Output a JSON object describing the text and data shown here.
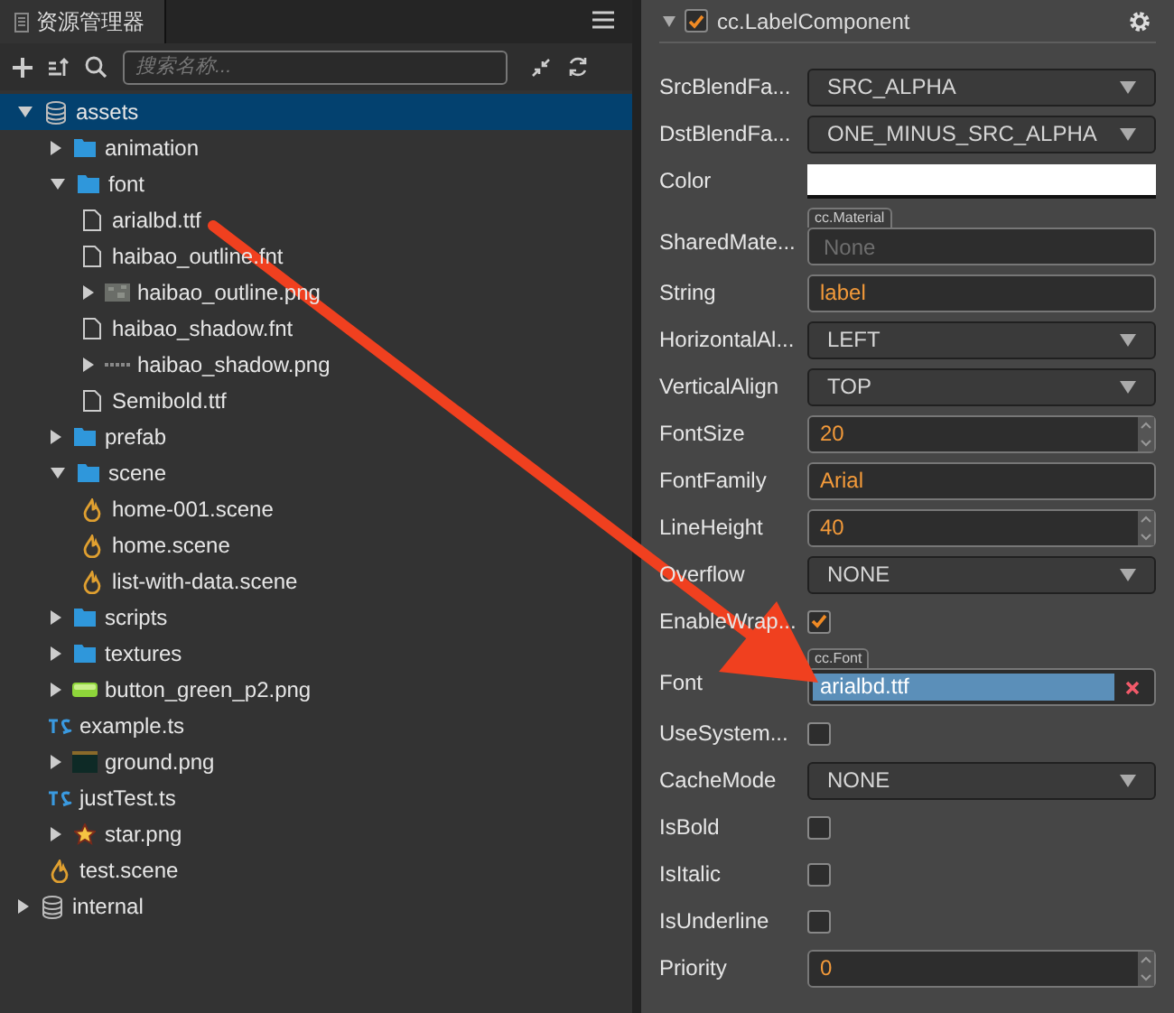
{
  "assets_panel": {
    "tab": {
      "label": "资源管理器",
      "selected": true
    },
    "search": {
      "placeholder": "搜索名称..."
    },
    "tree": [
      {
        "kind": "db",
        "name": "assets",
        "selected": true,
        "expanded": true,
        "children": [
          {
            "kind": "folder",
            "name": "animation",
            "selected": false,
            "expanded": false
          },
          {
            "kind": "folder",
            "name": "font",
            "selected": false,
            "expanded": true,
            "children": [
              {
                "kind": "file",
                "name": "arialbd.ttf",
                "selected": false
              },
              {
                "kind": "file",
                "name": "haibao_outline.fnt",
                "selected": false
              },
              {
                "kind": "texture",
                "name": "haibao_outline.png",
                "selected": false,
                "expanded": false
              },
              {
                "kind": "file",
                "name": "haibao_shadow.fnt",
                "selected": false
              },
              {
                "kind": "strip",
                "name": "haibao_shadow.png",
                "selected": false,
                "expanded": false
              },
              {
                "kind": "file",
                "name": "Semibold.ttf",
                "selected": false
              }
            ]
          },
          {
            "kind": "folder",
            "name": "prefab",
            "selected": false,
            "expanded": false
          },
          {
            "kind": "folder",
            "name": "scene",
            "selected": false,
            "expanded": true,
            "children": [
              {
                "kind": "scene",
                "name": "home-001.scene",
                "selected": false
              },
              {
                "kind": "scene",
                "name": "home.scene",
                "selected": false
              },
              {
                "kind": "scene",
                "name": "list-with-data.scene",
                "selected": false
              }
            ]
          },
          {
            "kind": "folder",
            "name": "scripts",
            "selected": false,
            "expanded": false
          },
          {
            "kind": "folder",
            "name": "textures",
            "selected": false,
            "expanded": false
          },
          {
            "kind": "greenbar",
            "name": "button_green_p2.png",
            "selected": false,
            "expanded": false
          },
          {
            "kind": "ts",
            "name": "example.ts",
            "selected": false
          },
          {
            "kind": "ground",
            "name": "ground.png",
            "selected": false,
            "expanded": false
          },
          {
            "kind": "ts",
            "name": "justTest.ts",
            "selected": false
          },
          {
            "kind": "star",
            "name": "star.png",
            "selected": false,
            "expanded": false
          },
          {
            "kind": "scene",
            "name": "test.scene",
            "selected": false
          }
        ]
      },
      {
        "kind": "db",
        "name": "internal",
        "selected": false,
        "expanded": false
      }
    ]
  },
  "inspector": {
    "component": {
      "name": "cc.LabelComponent",
      "enabled": true,
      "expanded": true
    },
    "properties": [
      {
        "kind": "select",
        "label": "SrcBlendFa...",
        "value": "SRC_ALPHA"
      },
      {
        "kind": "select",
        "label": "DstBlendFa...",
        "value": "ONE_MINUS_SRC_ALPHA"
      },
      {
        "kind": "color",
        "label": "Color",
        "color": "#ffffff"
      },
      {
        "kind": "asset",
        "label": "SharedMate...",
        "type_tag": "cc.Material",
        "placeholder": "None"
      },
      {
        "kind": "text",
        "label": "String",
        "value": "label"
      },
      {
        "kind": "select",
        "label": "HorizontalAl...",
        "value": "LEFT"
      },
      {
        "kind": "select",
        "label": "VerticalAlign",
        "value": "TOP"
      },
      {
        "kind": "number",
        "label": "FontSize",
        "value": "20"
      },
      {
        "kind": "text",
        "label": "FontFamily",
        "value": "Arial"
      },
      {
        "kind": "number",
        "label": "LineHeight",
        "value": "40"
      },
      {
        "kind": "select",
        "label": "Overflow",
        "value": "NONE"
      },
      {
        "kind": "checkbox",
        "label": "EnableWrap...",
        "checked": true
      },
      {
        "kind": "asset",
        "label": "Font",
        "type_tag": "cc.Font",
        "value": "arialbd.ttf"
      },
      {
        "kind": "checkbox",
        "label": "UseSystem...",
        "checked": false
      },
      {
        "kind": "select",
        "label": "CacheMode",
        "value": "NONE"
      },
      {
        "kind": "checkbox",
        "label": "IsBold",
        "checked": false
      },
      {
        "kind": "checkbox",
        "label": "IsItalic",
        "checked": false
      },
      {
        "kind": "checkbox",
        "label": "IsUnderline",
        "checked": false
      },
      {
        "kind": "number",
        "label": "Priority",
        "value": "0"
      }
    ]
  }
}
